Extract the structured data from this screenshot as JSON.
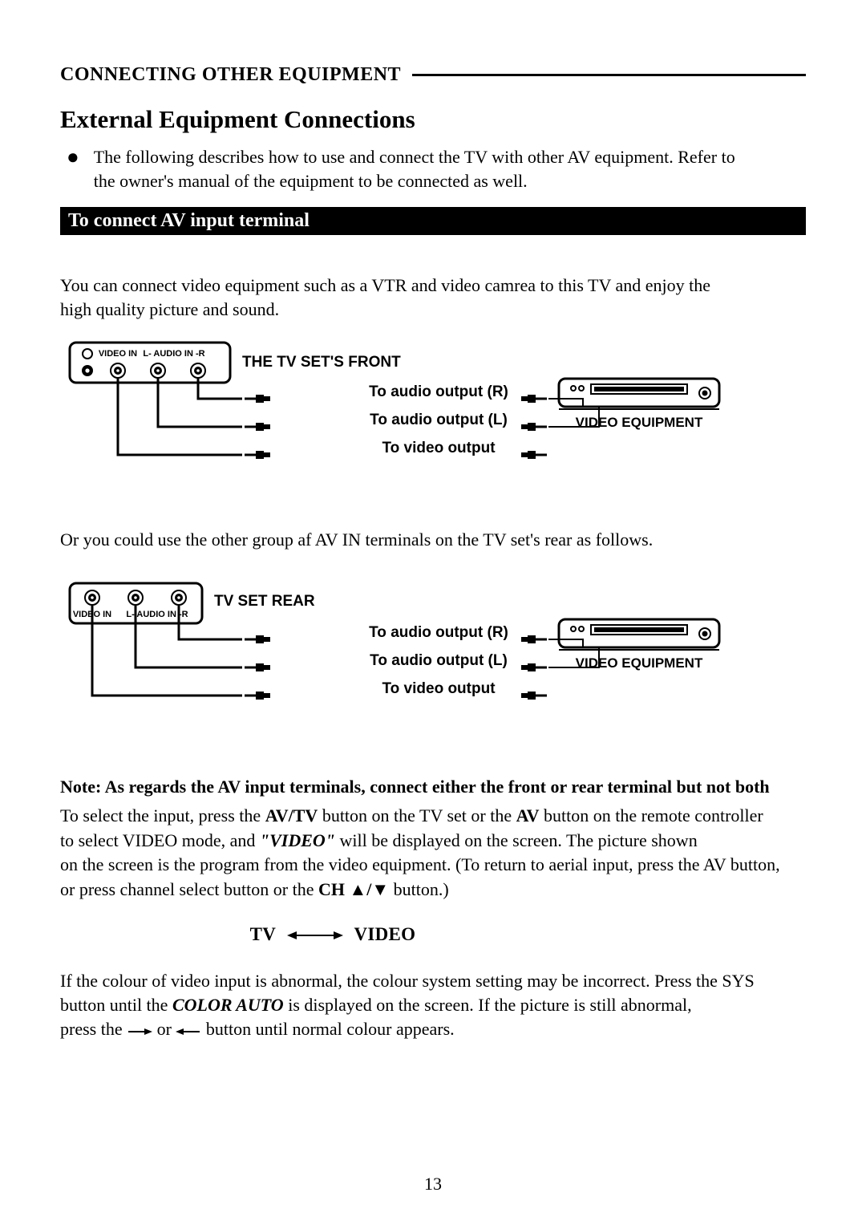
{
  "header": {
    "title": "CONNECTING OTHER EQUIPMENT"
  },
  "heading": "External Equipment Connections",
  "bullet": {
    "line1": "The following describes how to use and connect the TV with other AV equipment. Refer to",
    "line2": "the owner's manual of the equipment to be connected as well."
  },
  "subbar": "To connect AV input terminal",
  "intro": {
    "line1": "You can connect video equipment such as a VTR and video camrea to this TV and enjoy the",
    "line2": "high quality picture and sound."
  },
  "diagram1": {
    "panel_title": "THE TV SET'S FRONT",
    "jack_video": "VIDEO IN",
    "jack_audio": "L- AUDIO IN -R",
    "cable_r": "To audio output (R)",
    "cable_l": "To audio output (L)",
    "cable_v": "To video output",
    "equipment": "VIDEO EQUIPMENT"
  },
  "mid": "Or you could use the other group af AV IN terminals on the TV set's rear as follows.",
  "diagram2": {
    "panel_title": "TV SET REAR",
    "jack_video": "VIDEO IN",
    "jack_audio": "L- AUDIO IN -R",
    "cable_r": "To audio output (R)",
    "cable_l": "To audio output (L)",
    "cable_v": "To video output",
    "equipment": "VIDEO EQUIPMENT"
  },
  "note": "Note: As regards the AV input terminals, connect either the front or rear terminal but not  both",
  "select": {
    "pre1": "To select the input, press the ",
    "avtv": "AV/TV",
    "mid1": " button on the TV set or the ",
    "av": "AV",
    "post1": " button on the remote controller",
    "line2a": "to select VIDEO mode, and ",
    "video": "\"VIDEO\"",
    "line2b": " will be displayed on the screen. The picture shown",
    "line3": "on the screen is the program from the video equipment. (To return to aerial input, press the AV button,",
    "line4a": "or press channel select button or the ",
    "ch": "CH ▲/▼",
    "line4b": "  button.)"
  },
  "tvvideo": {
    "tv": "TV",
    "video": "VIDEO"
  },
  "colour": {
    "l1": "If the colour of video input is abnormal, the colour system setting may be incorrect. Press the SYS",
    "l2a": "button until the ",
    "colorauto": "COLOR AUTO",
    "l2b": " is displayed on the screen. If the picture is still abnormal,",
    "l3a": "press the ",
    "l3b": " or ",
    "l3c": " button until normal colour appears."
  },
  "page_number": "13"
}
